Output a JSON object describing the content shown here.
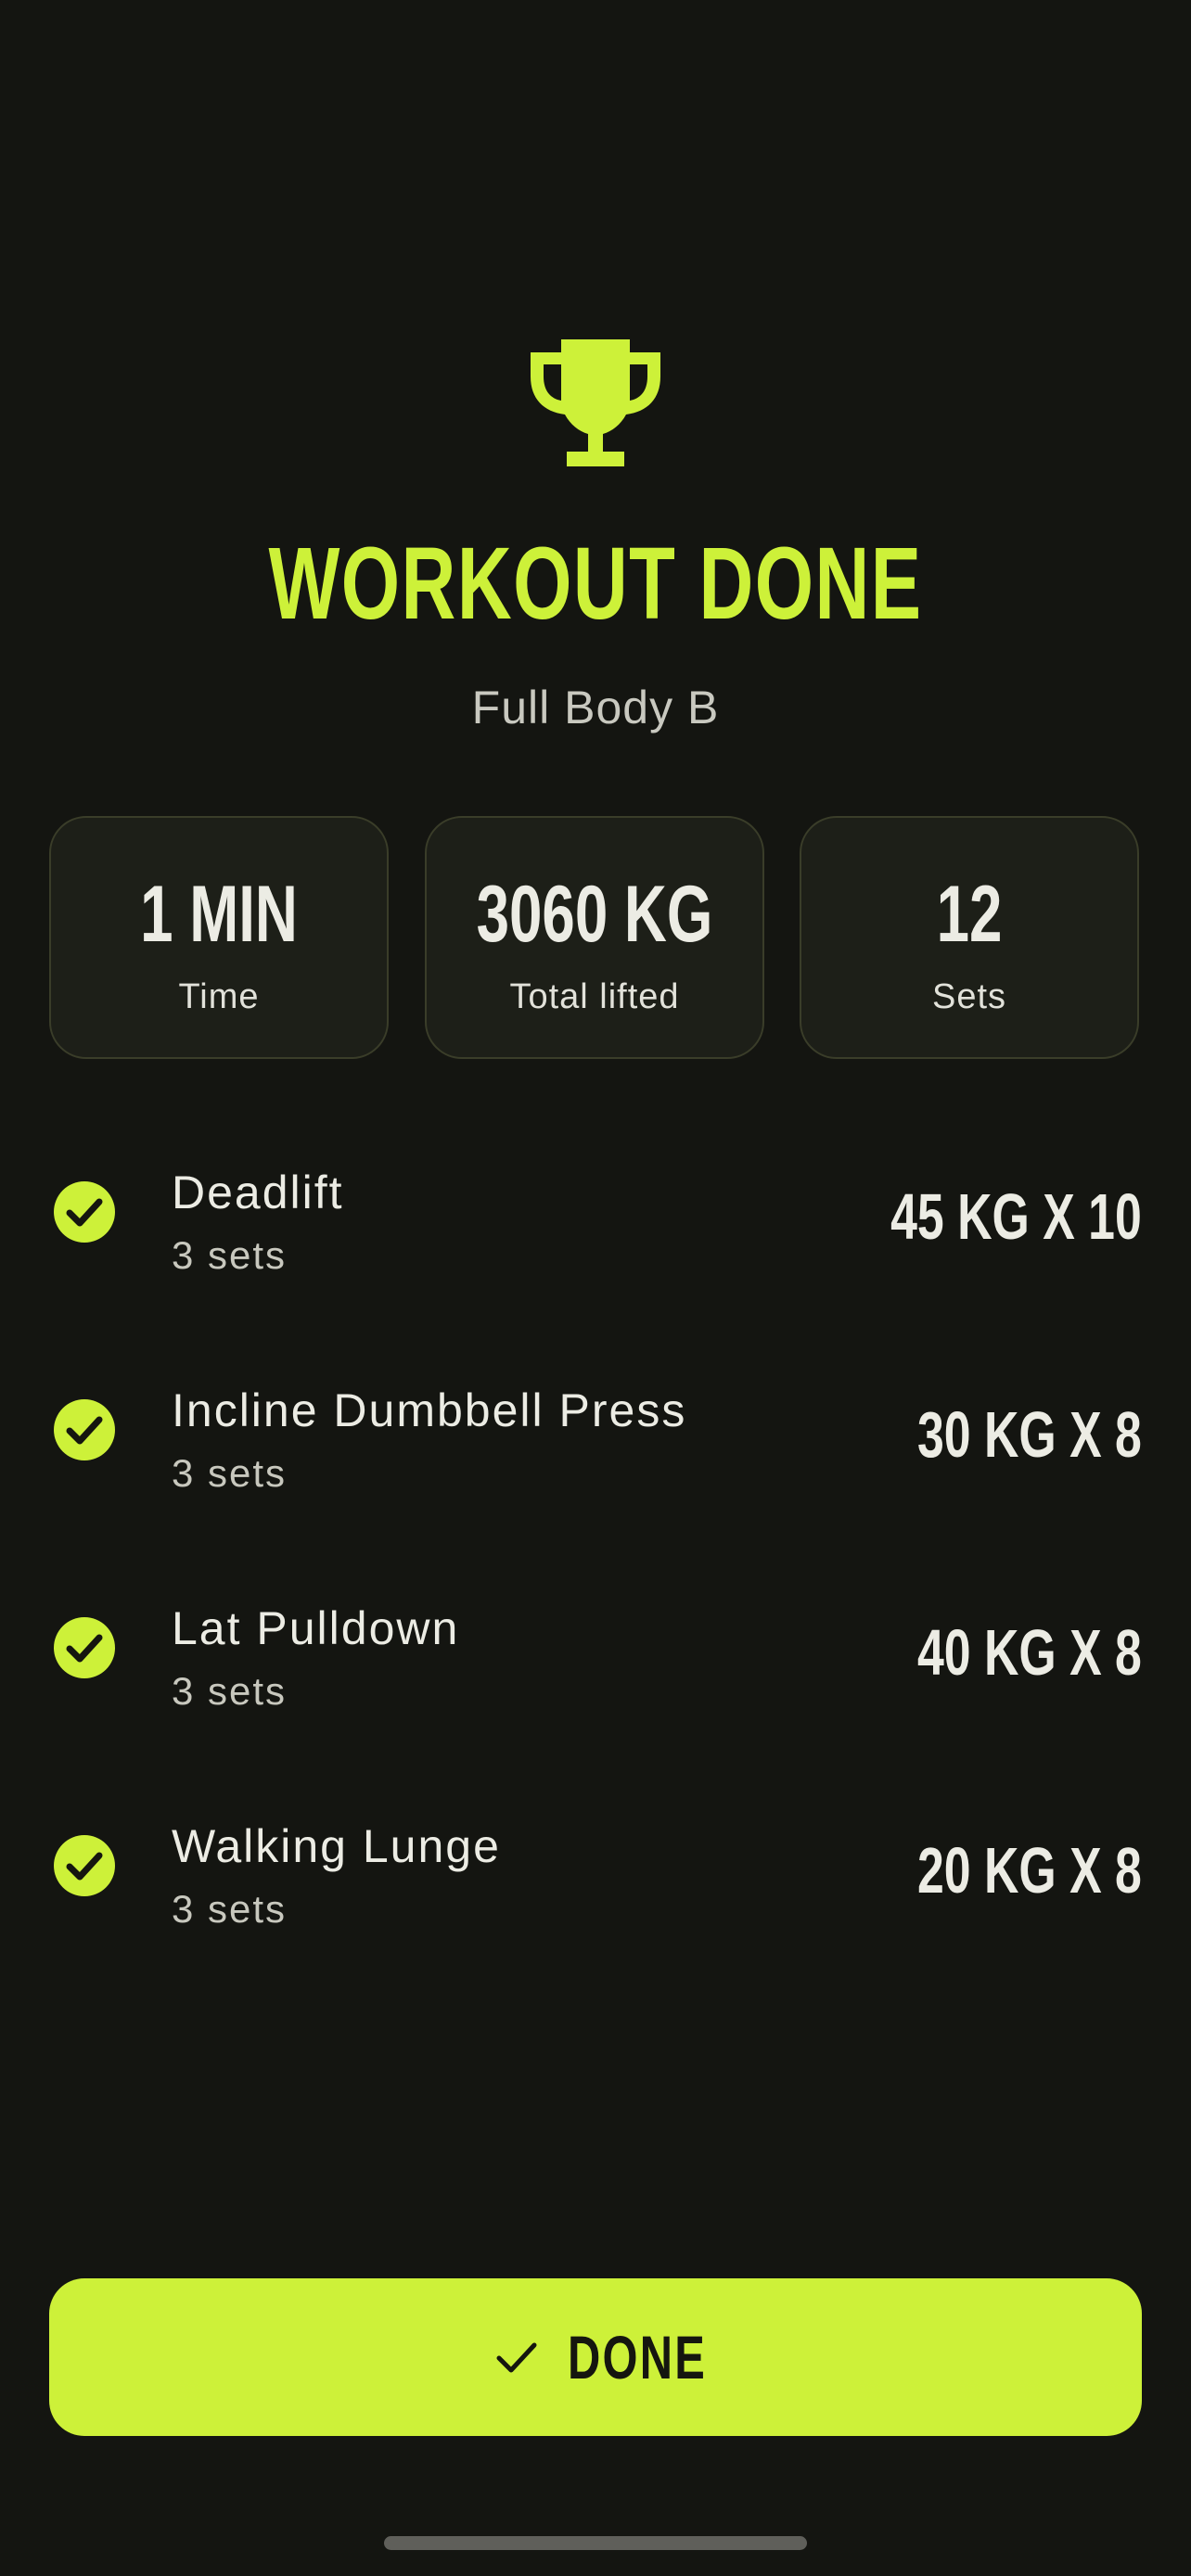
{
  "header": {
    "icon": "trophy-icon",
    "title": "WORKOUT DONE",
    "subtitle": "Full Body B"
  },
  "stats": [
    {
      "value": "1 MIN",
      "label": "Time"
    },
    {
      "value": "3060 KG",
      "label": "Total lifted"
    },
    {
      "value": "12",
      "label": "Sets"
    }
  ],
  "exercises": [
    {
      "name": "Deadlift",
      "sets": "3 sets",
      "weight": "45 KG X 10",
      "icon": "check-circle-icon"
    },
    {
      "name": "Incline Dumbbell Press",
      "sets": "3 sets",
      "weight": "30 KG X 8",
      "icon": "check-circle-icon"
    },
    {
      "name": "Lat Pulldown",
      "sets": "3 sets",
      "weight": "40 KG X 8",
      "icon": "check-circle-icon"
    },
    {
      "name": "Walking Lunge",
      "sets": "3 sets",
      "weight": "20 KG X 8",
      "icon": "check-circle-icon"
    }
  ],
  "done_button": {
    "label": "DONE",
    "icon": "checkmark-icon"
  },
  "colors": {
    "background": "#141511",
    "accent": "#cdf139",
    "card": "#1d1f18",
    "card_border": "#3a3d29",
    "text": "#ecece4",
    "muted_text": "#c8c8be"
  }
}
